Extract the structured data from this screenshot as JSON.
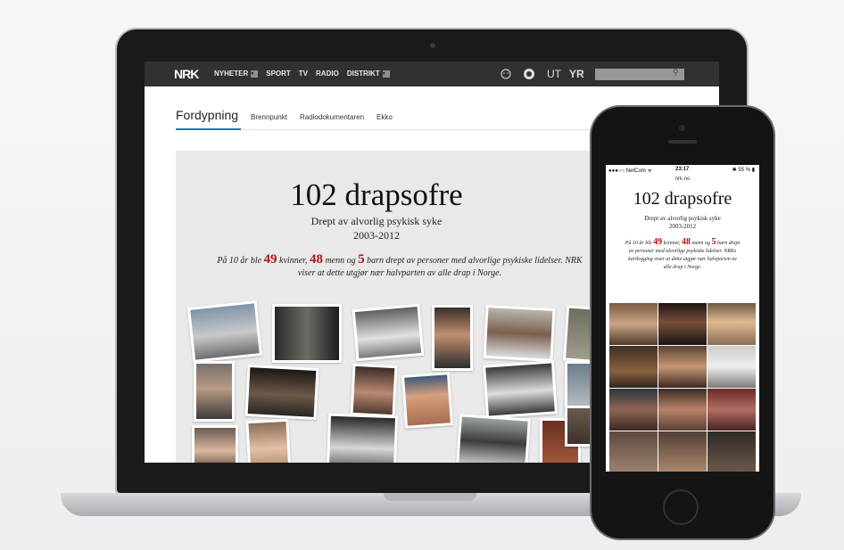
{
  "site": {
    "logo": "NRK",
    "nav": [
      "NYHETER",
      "SPORT",
      "TV",
      "RADIO",
      "DISTRIKT"
    ],
    "nav_dropdown_glyph": "▾",
    "ut_label": "UT",
    "yr_label": "YR",
    "search_glyph": "⚲"
  },
  "subnav": {
    "title": "Fordypning",
    "links": [
      "Brennpunkt",
      "Radiodokumentaren",
      "Ekko"
    ]
  },
  "article": {
    "title": "102 drapsofre",
    "subtitle": "Drept av alvorlig psykisk syke",
    "years": "2003-2012",
    "intro_a": "På 10 år ble ",
    "n_women": "49",
    "intro_b": " kvinner, ",
    "n_men": "48",
    "intro_c": " menn og ",
    "n_children": "5",
    "intro_d": " barn drept av personer med alvorlige psykiske lidelser. NRKs kartlegging viser at dette utgjør nær halvparten av alle drap i Norge.",
    "intro_d_laptop": " barn drept av personer med alvorlige psykiske lidelser. NRK",
    "intro_d_laptop_2": "viser at dette utgjør nær halvparten av alle drap i Norge."
  },
  "phone": {
    "carrier": "●●●○○ NetCom ᯤ",
    "time": "23:17",
    "battery": "✱ 55 % ▮",
    "url": "nrk.no",
    "intro_d": " barn drept av personer med alvorlige psykiske lidelser. NRKs kartlegging viser at dette utgjør nær halvparten av alle drap i Norge."
  },
  "colors": {
    "accent": "#b31217",
    "tab_underline": "#1f7ab8",
    "navbar": "#2f3133"
  }
}
